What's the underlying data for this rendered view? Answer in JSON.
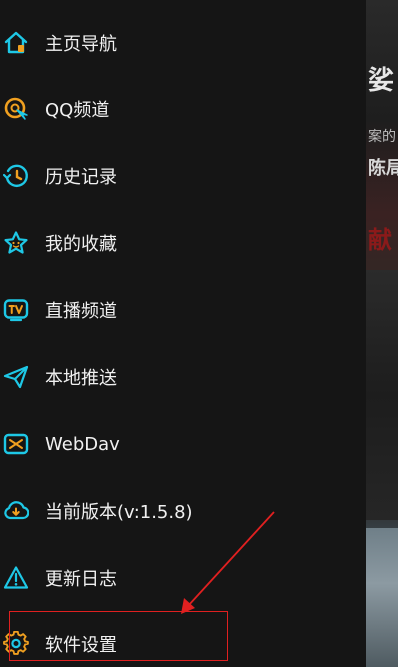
{
  "background_peek": {
    "line1": "娑",
    "line2": "案的",
    "line3": "陈局",
    "line4": "献"
  },
  "menu": {
    "items": [
      {
        "label": "主页导航",
        "icon": "home-icon"
      },
      {
        "label": "QQ频道",
        "icon": "qq-channel-icon"
      },
      {
        "label": "历史记录",
        "icon": "history-icon"
      },
      {
        "label": "我的收藏",
        "icon": "star-icon"
      },
      {
        "label": "直播频道",
        "icon": "tv-icon"
      },
      {
        "label": "本地推送",
        "icon": "send-icon"
      },
      {
        "label": "WebDav",
        "icon": "webdav-icon"
      },
      {
        "label": "当前版本(v:1.5.8)",
        "icon": "cloud-download-icon"
      },
      {
        "label": "更新日志",
        "icon": "warning-icon"
      },
      {
        "label": "软件设置",
        "icon": "gear-icon"
      }
    ]
  },
  "colors": {
    "accent_cyan": "#1ec8e6",
    "accent_orange": "#f0a020",
    "annotation_red": "#e02020",
    "drawer_bg": "#151515",
    "text": "#f0f0f0"
  }
}
